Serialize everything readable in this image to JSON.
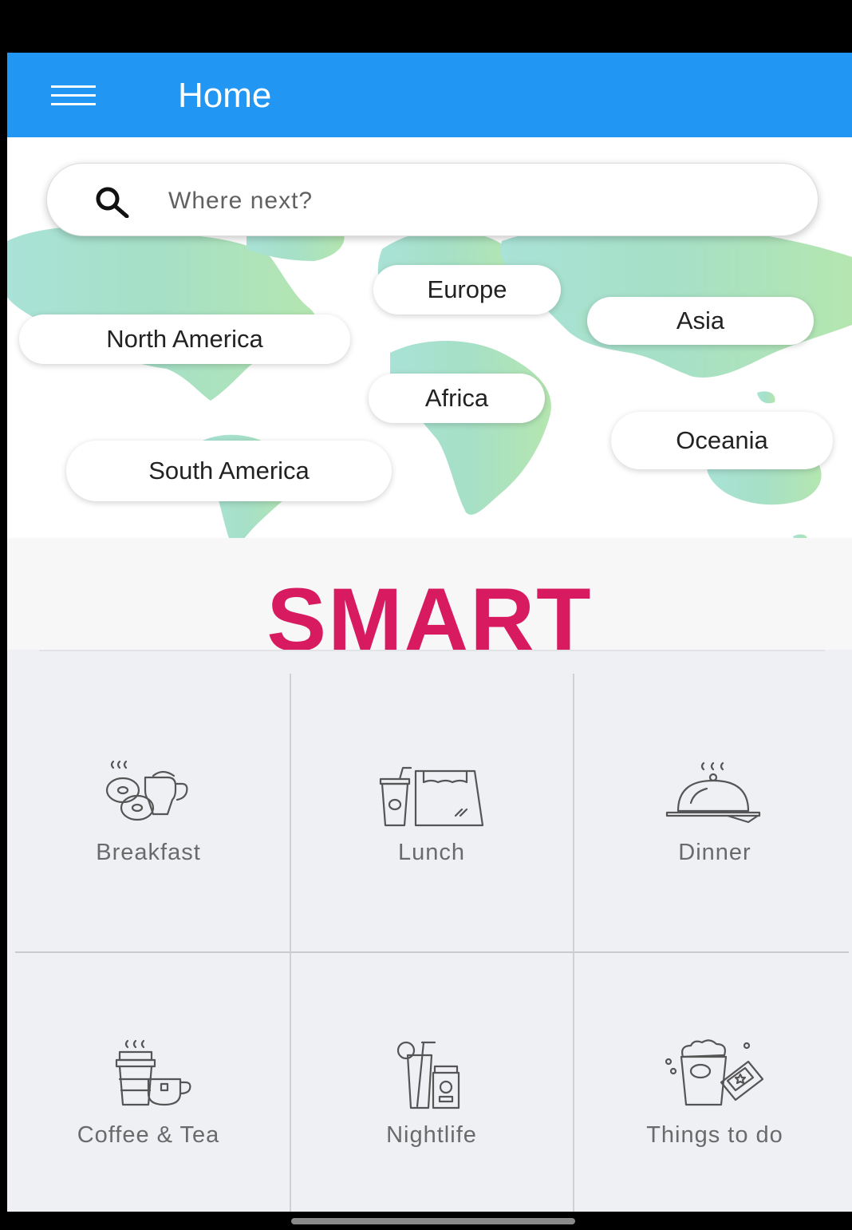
{
  "app_bar": {
    "title": "Home",
    "menu_icon": "hamburger-menu-icon",
    "color": "#2196f3"
  },
  "search": {
    "placeholder": "Where next?",
    "value": "",
    "icon": "search-icon"
  },
  "regions": [
    {
      "label": "North America"
    },
    {
      "label": "Europe"
    },
    {
      "label": "Asia"
    },
    {
      "label": "Africa"
    },
    {
      "label": "Oceania"
    },
    {
      "label": "South America"
    }
  ],
  "brand": {
    "logo_text": "SMART",
    "color": "#d81b60"
  },
  "categories": [
    {
      "label": "Breakfast",
      "icon": "breakfast-icon"
    },
    {
      "label": "Lunch",
      "icon": "lunch-icon"
    },
    {
      "label": "Dinner",
      "icon": "dinner-icon"
    },
    {
      "label": "Coffee & Tea",
      "icon": "coffee-tea-icon"
    },
    {
      "label": "Nightlife",
      "icon": "nightlife-icon"
    },
    {
      "label": "Things to do",
      "icon": "things-to-do-icon"
    }
  ]
}
